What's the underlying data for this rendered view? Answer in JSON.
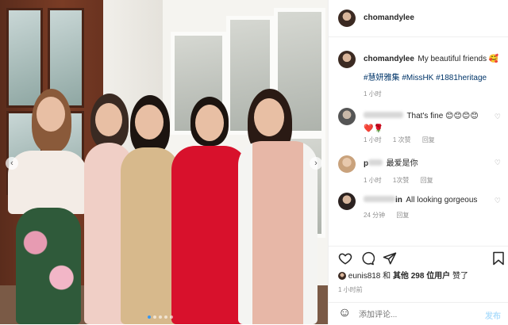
{
  "post": {
    "author": "chomandylee",
    "caption_user": "chomandylee",
    "caption_text": "My beautiful friends 🥰",
    "hashtags": "#慧妍雅集 #MissHK #1881heritage",
    "caption_time": "1 小时"
  },
  "comments": [
    {
      "user": "",
      "text": "That's fine 😊😊😊😊",
      "text2": "❤️🌹",
      "time": "1 小时",
      "likes": "1 次赞",
      "reply": "回复"
    },
    {
      "user": "p",
      "text": "最爱是你",
      "time": "1 小时",
      "likes": "1次赞",
      "reply": "回复"
    },
    {
      "user": "in",
      "text": "All looking gorgeous",
      "time": "24 分钟",
      "reply": "回复"
    }
  ],
  "actions": {
    "like_icon": "heart-icon",
    "comment_icon": "comment-icon",
    "share_icon": "share-icon",
    "save_icon": "bookmark-icon"
  },
  "likes": {
    "user": "eunis818",
    "conj": "和",
    "others": "其他",
    "count": "298",
    "unit": "位用户",
    "suffix": "赞了"
  },
  "post_time": "1 小时前",
  "add_comment": {
    "placeholder": "添加评论...",
    "submit": "发布"
  },
  "colors": {
    "link": "#003569",
    "accent": "#3897f0",
    "meta": "#8e8e8e"
  }
}
